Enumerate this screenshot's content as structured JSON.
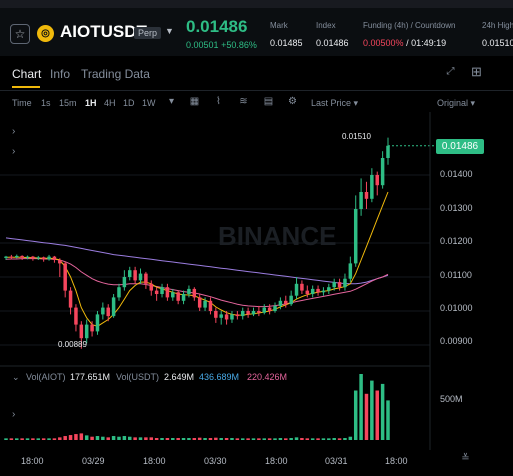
{
  "header": {
    "favorite_icon": "star-outline-icon",
    "symbol": "AIOTUSDT",
    "badge": "Perp",
    "last_price": "0.01486",
    "change": "0.00501",
    "change_pct": "+50.86%",
    "stats": [
      {
        "label": "Mark",
        "value": "0.01485"
      },
      {
        "label": "Index",
        "value": "0.01486"
      },
      {
        "label": "Funding (4h) / Countdown",
        "value": "0.00500%",
        "countdown": "/ 01:49:19"
      },
      {
        "label": "24h High",
        "value": "0.01510"
      }
    ]
  },
  "tabs": [
    "Chart",
    "Info",
    "Trading Data"
  ],
  "toolbar": {
    "intervals": [
      "Time",
      "1s",
      "15m",
      "1H",
      "4H",
      "1D",
      "1W"
    ],
    "active_interval": "1H",
    "price_type": "Last Price",
    "view_mode": "Original"
  },
  "chart_data": {
    "type": "candlestick",
    "y_ticks": [
      "0.01400",
      "0.01300",
      "0.01200",
      "0.01100",
      "0.01000",
      "0.00900"
    ],
    "x_ticks": [
      "18:00",
      "03/29",
      "18:00",
      "03/30",
      "18:00",
      "03/31",
      "18:00"
    ],
    "ylim": [
      0.0085,
      0.0155
    ],
    "current_price_label": "0.01486",
    "high_label": "0.01510",
    "low_label": "0.00889",
    "watermark": "BINANCE",
    "candles": [
      [
        0.01156,
        0.0116,
        0.0115,
        0.01162
      ],
      [
        0.0116,
        0.01158,
        0.01152,
        0.01165
      ],
      [
        0.01158,
        0.01162,
        0.01155,
        0.01166
      ],
      [
        0.01162,
        0.01157,
        0.0115,
        0.01164
      ],
      [
        0.01157,
        0.0116,
        0.01152,
        0.01163
      ],
      [
        0.0116,
        0.01155,
        0.01148,
        0.01162
      ],
      [
        0.01155,
        0.01158,
        0.0115,
        0.01162
      ],
      [
        0.01158,
        0.01152,
        0.01145,
        0.0116
      ],
      [
        0.01152,
        0.0116,
        0.01148,
        0.01165
      ],
      [
        0.0116,
        0.0115,
        0.01142,
        0.01162
      ],
      [
        0.0115,
        0.0114,
        0.011,
        0.01155
      ],
      [
        0.0114,
        0.0106,
        0.0104,
        0.01145
      ],
      [
        0.0106,
        0.0101,
        0.0099,
        0.0107
      ],
      [
        0.0101,
        0.0096,
        0.0094,
        0.0102
      ],
      [
        0.0096,
        0.0092,
        0.00889,
        0.0097
      ],
      [
        0.0092,
        0.0096,
        0.00905,
        0.00975
      ],
      [
        0.0096,
        0.0094,
        0.00925,
        0.0097
      ],
      [
        0.0094,
        0.0099,
        0.0093,
        0.01
      ],
      [
        0.0099,
        0.0101,
        0.00975,
        0.01025
      ],
      [
        0.0101,
        0.00985,
        0.0097,
        0.0102
      ],
      [
        0.00985,
        0.0104,
        0.0098,
        0.0105
      ],
      [
        0.0104,
        0.0107,
        0.0103,
        0.0108
      ],
      [
        0.0107,
        0.011,
        0.0106,
        0.0112
      ],
      [
        0.011,
        0.0112,
        0.0109,
        0.0113
      ],
      [
        0.0112,
        0.0109,
        0.0108,
        0.0113
      ],
      [
        0.0109,
        0.0111,
        0.0108,
        0.01125
      ],
      [
        0.0111,
        0.0108,
        0.01065,
        0.01115
      ],
      [
        0.0108,
        0.0106,
        0.01045,
        0.0109
      ],
      [
        0.0106,
        0.0105,
        0.0103,
        0.0107
      ],
      [
        0.0105,
        0.0107,
        0.0104,
        0.0108
      ],
      [
        0.0107,
        0.0104,
        0.0103,
        0.0108
      ],
      [
        0.0104,
        0.01055,
        0.0103,
        0.01065
      ],
      [
        0.01055,
        0.0103,
        0.0102,
        0.0106
      ],
      [
        0.0103,
        0.0105,
        0.0102,
        0.0106
      ],
      [
        0.0105,
        0.01065,
        0.0104,
        0.01075
      ],
      [
        0.01065,
        0.0104,
        0.0103,
        0.0107
      ],
      [
        0.0104,
        0.0101,
        0.01,
        0.0105
      ],
      [
        0.0101,
        0.0103,
        0.01,
        0.0104
      ],
      [
        0.0103,
        0.01,
        0.0099,
        0.0104
      ],
      [
        0.01,
        0.0098,
        0.00965,
        0.0101
      ],
      [
        0.0098,
        0.0099,
        0.0096,
        0.01
      ],
      [
        0.0099,
        0.00975,
        0.0096,
        0.01
      ],
      [
        0.00975,
        0.0099,
        0.00965,
        0.01
      ],
      [
        0.0099,
        0.00985,
        0.00975,
        0.01
      ],
      [
        0.00985,
        0.01,
        0.00975,
        0.0101
      ],
      [
        0.01,
        0.0099,
        0.0098,
        0.0101
      ],
      [
        0.0099,
        0.01,
        0.00985,
        0.0101
      ],
      [
        0.01,
        0.00995,
        0.00985,
        0.01015
      ],
      [
        0.00995,
        0.0101,
        0.0099,
        0.0102
      ],
      [
        0.0101,
        0.01,
        0.0099,
        0.0102
      ],
      [
        0.01,
        0.01015,
        0.00995,
        0.01025
      ],
      [
        0.01015,
        0.0103,
        0.01005,
        0.0104
      ],
      [
        0.0103,
        0.0102,
        0.0101,
        0.01045
      ],
      [
        0.0102,
        0.01045,
        0.01015,
        0.0106
      ],
      [
        0.01045,
        0.0108,
        0.01035,
        0.011
      ],
      [
        0.0108,
        0.0106,
        0.0105,
        0.0109
      ],
      [
        0.0106,
        0.0105,
        0.0104,
        0.01075
      ],
      [
        0.0105,
        0.01065,
        0.0104,
        0.01075
      ],
      [
        0.01065,
        0.01055,
        0.01045,
        0.01075
      ],
      [
        0.01055,
        0.0106,
        0.01045,
        0.0107
      ],
      [
        0.0106,
        0.0107,
        0.0105,
        0.0108
      ],
      [
        0.0107,
        0.01085,
        0.0106,
        0.01095
      ],
      [
        0.01085,
        0.0107,
        0.0106,
        0.01095
      ],
      [
        0.0107,
        0.01095,
        0.0106,
        0.0111
      ],
      [
        0.01095,
        0.0114,
        0.01085,
        0.0116
      ],
      [
        0.0114,
        0.013,
        0.0113,
        0.0134
      ],
      [
        0.013,
        0.0135,
        0.0128,
        0.0139
      ],
      [
        0.0135,
        0.0133,
        0.013,
        0.0138
      ],
      [
        0.0133,
        0.014,
        0.0132,
        0.0142
      ],
      [
        0.014,
        0.0137,
        0.0134,
        0.0141
      ],
      [
        0.0137,
        0.0145,
        0.0136,
        0.0147
      ],
      [
        0.0145,
        0.01486,
        0.0143,
        0.0151
      ]
    ],
    "ma_yellow": [
      0.01158,
      0.01158,
      0.01158,
      0.01158,
      0.01157,
      0.01157,
      0.01156,
      0.01155,
      0.01155,
      0.01154,
      0.0115,
      0.0113,
      0.011,
      0.0106,
      0.0101,
      0.0098,
      0.0096,
      0.00955,
      0.00965,
      0.00975,
      0.0099,
      0.0101,
      0.01035,
      0.0106,
      0.01075,
      0.01085,
      0.01085,
      0.0108,
      0.0107,
      0.01065,
      0.0106,
      0.01055,
      0.0105,
      0.01048,
      0.01047,
      0.01045,
      0.01038,
      0.01032,
      0.01025,
      0.01012,
      0.01003,
      0.00995,
      0.0099,
      0.00988,
      0.00988,
      0.0099,
      0.00992,
      0.00994,
      0.00997,
      0.01,
      0.01005,
      0.01012,
      0.01018,
      0.01025,
      0.01035,
      0.01042,
      0.01048,
      0.01052,
      0.01055,
      0.01058,
      0.0106,
      0.01065,
      0.01068,
      0.01072,
      0.0108,
      0.0111,
      0.0115,
      0.0119,
      0.0123,
      0.0127,
      0.0131,
      0.0135
    ],
    "ma_pink": [
      0.01152,
      0.01153,
      0.01153,
      0.01154,
      0.01154,
      0.01154,
      0.01154,
      0.01153,
      0.01153,
      0.01152,
      0.0115,
      0.01145,
      0.01138,
      0.01128,
      0.01115,
      0.01105,
      0.01095,
      0.01088,
      0.01083,
      0.01079,
      0.01077,
      0.01077,
      0.01078,
      0.0108,
      0.0108,
      0.0108,
      0.01078,
      0.01075,
      0.01072,
      0.01069,
      0.01066,
      0.01063,
      0.0106,
      0.01057,
      0.01055,
      0.01053,
      0.0105,
      0.01046,
      0.01042,
      0.01037,
      0.01032,
      0.01028,
      0.01024,
      0.0102,
      0.01017,
      0.01015,
      0.01014,
      0.01013,
      0.01013,
      0.01014,
      0.01016,
      0.01018,
      0.01021,
      0.01024,
      0.01028,
      0.01031,
      0.01034,
      0.01037,
      0.0104,
      0.01043,
      0.01046,
      0.01049,
      0.01052,
      0.01055,
      0.01058,
      0.01064,
      0.01072,
      0.0108,
      0.01088,
      0.01095,
      0.011,
      0.01108
    ],
    "ma_purple": [
      0.01215,
      0.01213,
      0.01211,
      0.01209,
      0.01207,
      0.01205,
      0.01203,
      0.01201,
      0.01199,
      0.01197,
      0.01195,
      0.01193,
      0.0119,
      0.01187,
      0.01184,
      0.01181,
      0.01178,
      0.01175,
      0.01172,
      0.01169,
      0.01166,
      0.01164,
      0.01162,
      0.0116,
      0.01158,
      0.01156,
      0.01154,
      0.01152,
      0.0115,
      0.01148,
      0.01146,
      0.01144,
      0.01142,
      0.0114,
      0.01138,
      0.01136,
      0.01134,
      0.01132,
      0.0113,
      0.01128,
      0.01126,
      0.01124,
      0.01122,
      0.0112,
      0.01118,
      0.01116,
      0.01114,
      0.01112,
      0.0111,
      0.01108,
      0.01106,
      0.01104,
      0.01102,
      0.011,
      0.01098,
      0.01096,
      0.01094,
      0.01092,
      0.0109,
      0.01088,
      0.01086,
      0.01084,
      0.01082,
      0.01081,
      0.0108,
      0.0108,
      0.01082,
      0.01085,
      0.0109,
      0.01095,
      0.011,
      0.01105
    ],
    "volume_header": {
      "label1": "Vol(AIOT)",
      "val1": "177.651M",
      "label2": "Vol(USDT)",
      "val2": "2.649M",
      "val3": "436.689M",
      "val4": "220.426M"
    },
    "volume_tick": "500M",
    "volume": [
      5,
      5,
      5,
      5,
      5,
      5,
      5,
      5,
      5,
      5,
      8,
      12,
      15,
      18,
      20,
      14,
      10,
      12,
      10,
      8,
      12,
      10,
      12,
      10,
      8,
      8,
      8,
      8,
      6,
      6,
      6,
      6,
      6,
      6,
      6,
      6,
      7,
      6,
      6,
      7,
      6,
      6,
      6,
      5,
      5,
      5,
      5,
      5,
      5,
      5,
      5,
      6,
      5,
      6,
      8,
      6,
      5,
      5,
      5,
      5,
      5,
      6,
      5,
      6,
      10,
      150,
      200,
      140,
      180,
      150,
      170,
      120
    ]
  },
  "colors": {
    "up": "#2ebd85",
    "down": "#f6465d",
    "accent": "#f0b90b"
  }
}
